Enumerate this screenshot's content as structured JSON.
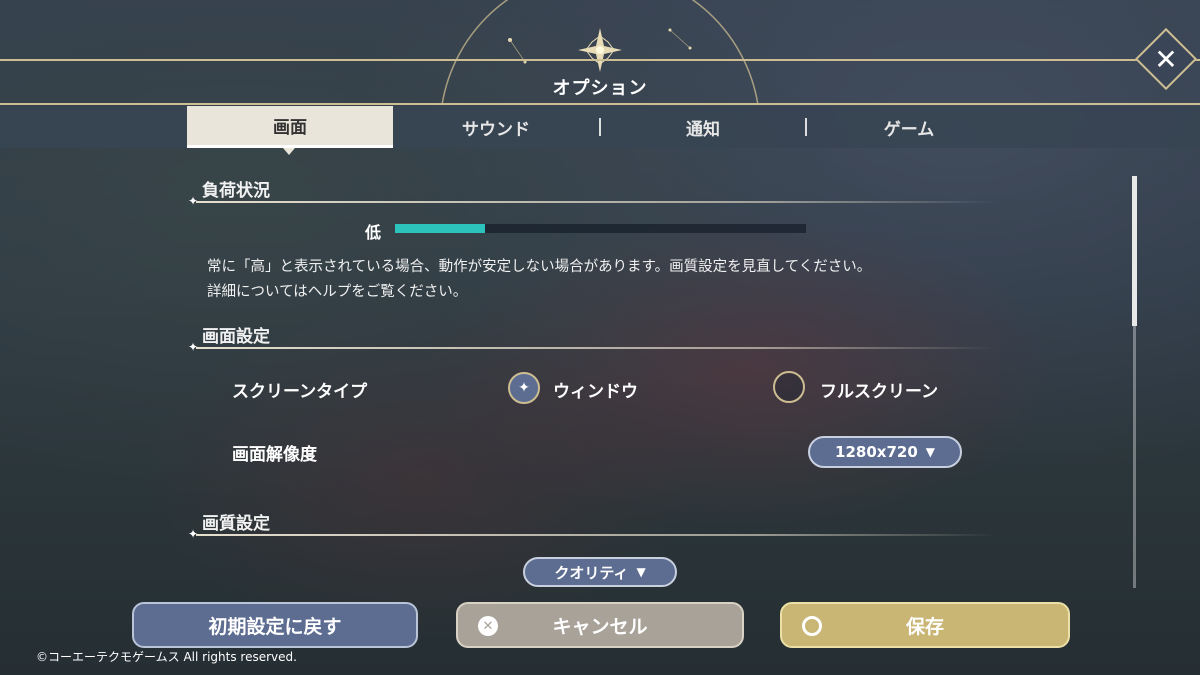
{
  "window": {
    "title": "オプション",
    "close_icon": "close-icon"
  },
  "tabs": [
    {
      "label": "画面",
      "active": true
    },
    {
      "label": "サウンド",
      "active": false
    },
    {
      "label": "通知",
      "active": false
    },
    {
      "label": "ゲーム",
      "active": false
    }
  ],
  "load_status": {
    "heading": "負荷状況",
    "level_label": "低",
    "level_fraction": 0.22,
    "bar_color": "#2bc3bb",
    "note_line1": "常に「高」と表示されている場合、動作が安定しない場合があります。画質設定を見直してください。",
    "note_line2": "詳細についてはヘルプをご覧ください。"
  },
  "screen_settings": {
    "heading": "画面設定",
    "screen_type": {
      "label": "スクリーンタイプ",
      "options": [
        {
          "label": "ウィンドウ",
          "selected": true
        },
        {
          "label": "フルスクリーン",
          "selected": false
        }
      ]
    },
    "resolution": {
      "label": "画面解像度",
      "value": "1280x720"
    }
  },
  "quality_settings": {
    "heading": "画質設定",
    "preset": "クオリティ"
  },
  "buttons": {
    "reset": "初期設定に戻す",
    "cancel": "キャンセル",
    "save": "保存"
  },
  "copyright": "©コーエーテクモゲームス All rights reserved.",
  "colors": {
    "accent_gold": "#cdbd92",
    "button_blue": "#5d6d92",
    "save_gold": "#c9b574"
  }
}
